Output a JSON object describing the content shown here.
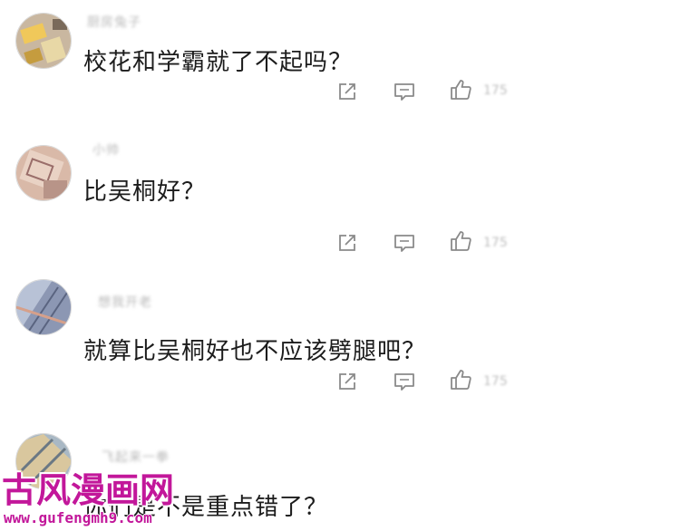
{
  "comments": [
    {
      "username": "厨房兔子",
      "text": "校花和学霸就了不起吗？",
      "likes": "175",
      "avatar_icon": "cartoon-avatar-icon"
    },
    {
      "username": "小帅",
      "text": "比吴桐好？",
      "likes": "175",
      "avatar_icon": "cartoon-avatar-icon"
    },
    {
      "username": "想我开老",
      "text": "就算比吴桐好也不应该劈腿吧？",
      "likes": "175",
      "avatar_icon": "cartoon-avatar-icon"
    },
    {
      "username": "飞起来一拳",
      "text": "你们是不是重点错了？",
      "avatar_icon": "cartoon-avatar-icon"
    }
  ],
  "actions": {
    "share_icon": "share-icon",
    "reply_icon": "reply-icon",
    "like_icon": "thumbs-up-icon"
  },
  "watermark": {
    "title": "古风漫画网",
    "url": "www.gufengmh9.com"
  },
  "colors": {
    "watermark": "#c2179a",
    "icon": "#8a8a8a"
  }
}
